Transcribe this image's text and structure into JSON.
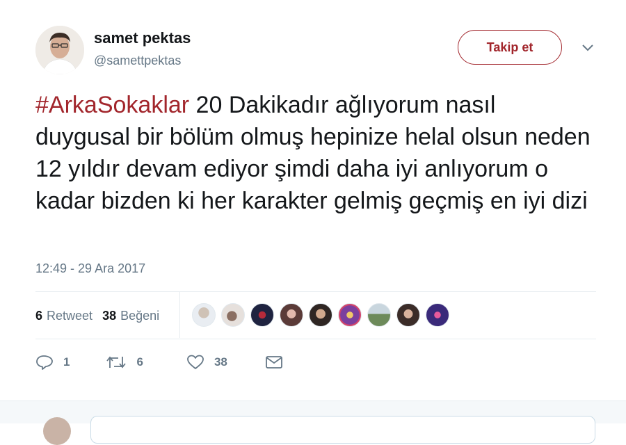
{
  "user": {
    "name": "samet pektas",
    "handle": "@samettpektas"
  },
  "follow_button": {
    "label": "Takip et"
  },
  "tweet": {
    "hashtag": "#ArkaSokaklar",
    "text": " 20 Dakikadır ağlıyorum nasıl duygusal bir bölüm olmuş hepinize helal olsun neden 12 yıldır devam ediyor şimdi daha iyi anlıyorum o kadar bizden ki her karakter gelmiş geçmiş en iyi dizi",
    "timestamp": "12:49 - 29 Ara 2017"
  },
  "stats": {
    "retweets_count": "6",
    "retweets_label": "Retweet",
    "likes_count": "38",
    "likes_label": "Beğeni"
  },
  "actions": {
    "reply_count": "1",
    "retweet_count": "6",
    "like_count": "38"
  },
  "colors": {
    "accent": "#a2262c",
    "text": "#14171a",
    "muted": "#657786",
    "divider": "#e6ecf0"
  },
  "icons": {
    "reply": "reply-icon",
    "retweet": "retweet-icon",
    "like": "heart-icon",
    "message": "envelope-icon",
    "menu": "chevron-down-icon"
  }
}
